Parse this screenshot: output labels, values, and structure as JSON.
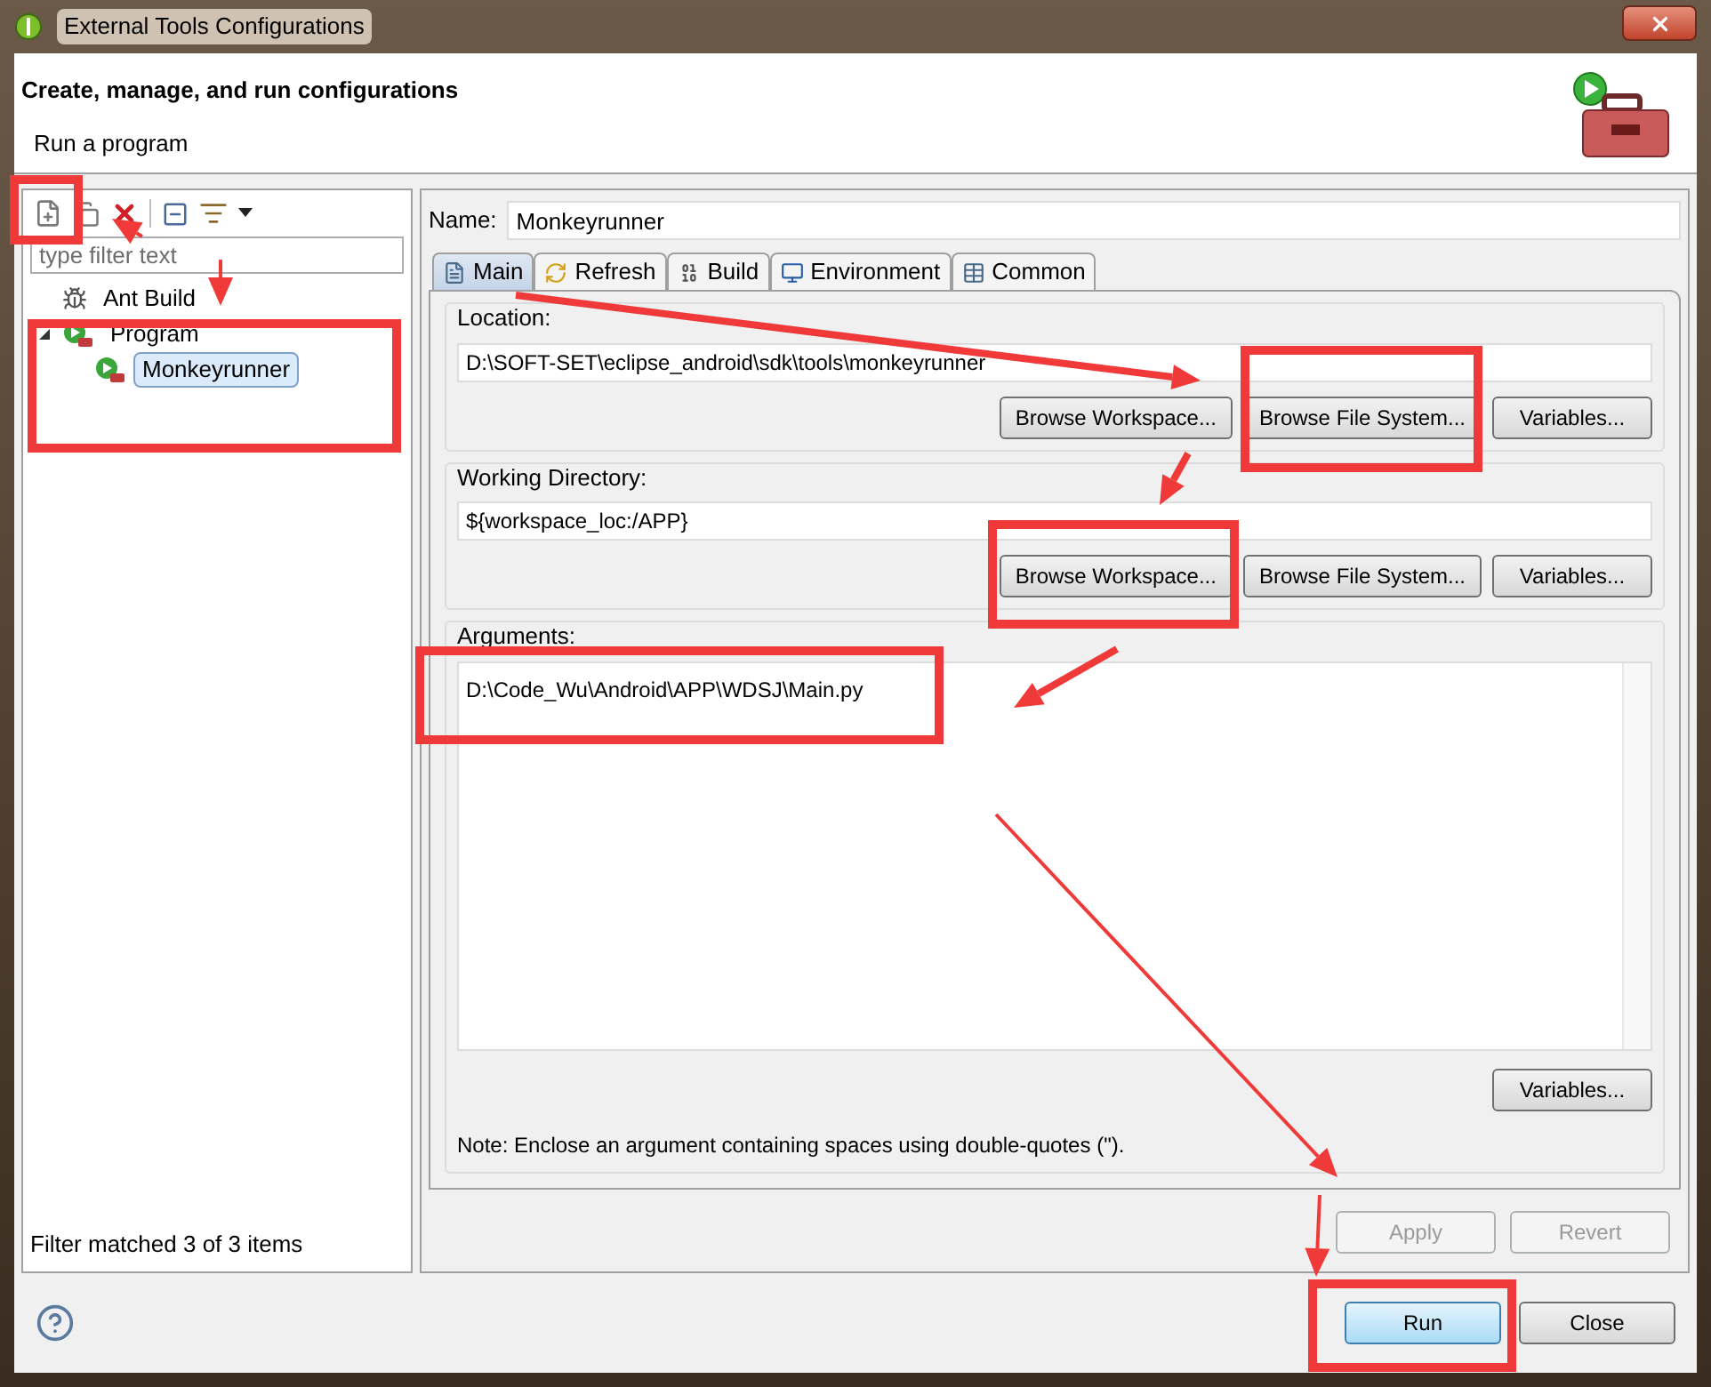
{
  "window": {
    "title": "External Tools Configurations"
  },
  "header": {
    "title": "Create, manage, and run configurations",
    "subtitle": "Run a program"
  },
  "filter": {
    "placeholder": "type filter text"
  },
  "tree": [
    {
      "label": "Ant Build",
      "kind": "ant",
      "selected": false
    },
    {
      "label": "Program",
      "kind": "program",
      "selected": false,
      "expanded": true,
      "children": [
        {
          "label": "Monkeyrunner",
          "kind": "program",
          "selected": true
        }
      ]
    }
  ],
  "filter_status": "Filter matched 3 of 3 items",
  "name": {
    "label": "Name:",
    "value": "Monkeyrunner"
  },
  "tabs": [
    {
      "label": "Main",
      "kind": "main",
      "selected": true
    },
    {
      "label": "Refresh",
      "kind": "refresh",
      "selected": false
    },
    {
      "label": "Build",
      "kind": "build",
      "selected": false
    },
    {
      "label": "Environment",
      "kind": "environment",
      "selected": false
    },
    {
      "label": "Common",
      "kind": "common",
      "selected": false
    }
  ],
  "groups": [
    {
      "label": "Location:",
      "value": "D:\\SOFT-SET\\eclipse_android\\sdk\\tools\\monkeyrunner",
      "buttons": [
        "Browse Workspace...",
        "Browse File System...",
        "Variables..."
      ]
    },
    {
      "label": "Working Directory:",
      "value": "${workspace_loc:/APP}",
      "buttons": [
        "Browse Workspace...",
        "Browse File System...",
        "Variables..."
      ]
    }
  ],
  "arguments": {
    "label": "Arguments:",
    "value": "D:\\Code_Wu\\Android\\APP\\WDSJ\\Main.py",
    "button": "Variables...",
    "note": "Note: Enclose an argument containing spaces using double-quotes (\")."
  },
  "actions": [
    {
      "label": "Apply",
      "disabled": true
    },
    {
      "label": "Revert",
      "disabled": true
    }
  ],
  "footer_buttons": [
    {
      "label": "Run",
      "kind": "primary"
    },
    {
      "label": "Close",
      "kind": "normal"
    }
  ]
}
